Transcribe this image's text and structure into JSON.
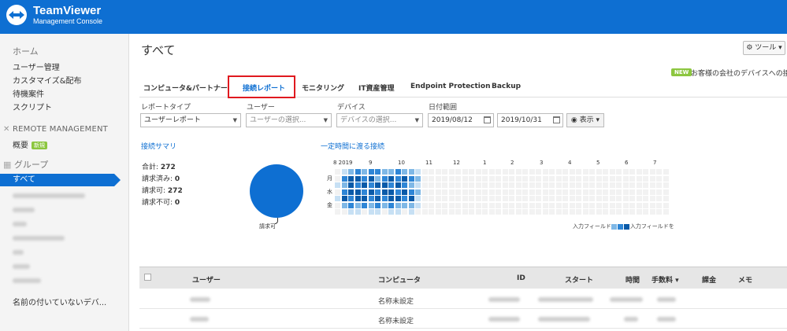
{
  "header": {
    "brand": "TeamViewer",
    "sub": "Management Console",
    "bg_color": "#0e6fd2"
  },
  "sidebar": {
    "home": "ホーム",
    "items": [
      "ユーザー管理",
      "カスタマイズ&配布",
      "待機案件",
      "スクリプト"
    ],
    "remote_heading": "REMOTE MANAGEMENT",
    "overview": "概要",
    "overview_badge": "新規",
    "groups_heading": "グループ",
    "active_group": "すべて",
    "unnamed": "名前の付いていないデバ..."
  },
  "main": {
    "title": "すべて",
    "tools_label": "ツール",
    "new_badge": "NEW",
    "new_text": "お客様の会社のデバイスへの接",
    "tabs": [
      "コンピュータ&パートナー",
      "接続レポート",
      "モニタリング",
      "IT資産管理",
      "Endpoint Protection",
      "Backup"
    ],
    "active_tab": 1
  },
  "filters": {
    "report_type_label": "レポートタイプ",
    "report_type_value": "ユーザーレポート",
    "user_label": "ユーザー",
    "user_placeholder": "ユーザーの選択...",
    "device_label": "デバイス",
    "device_placeholder": "デバイスの選択...",
    "date_label": "日付範囲",
    "date_from": "2019/08/12",
    "date_to": "2019/10/31",
    "show_label": "表示"
  },
  "summary": {
    "title": "接続サマリ",
    "total_label": "合計:",
    "total": "272",
    "billed_label": "請求済み:",
    "billed": "0",
    "billable_label": "請求可:",
    "billable": "272",
    "not_billable_label": "請求不可:",
    "not_billable": "0",
    "pie_label": "請求可"
  },
  "heatmap": {
    "title": "一定時間に渡る接続",
    "months": [
      "8 2019",
      "9",
      "10",
      "11",
      "12",
      "1",
      "2",
      "3",
      "4",
      "5",
      "6",
      "7"
    ],
    "days": [
      "月",
      "水",
      "金"
    ],
    "legend_left": "入力フィールド",
    "legend_right": "入力フィールドを",
    "colors": [
      "#f2f2f2",
      "#c7e0f4",
      "#7fb8e6",
      "#2f86d6",
      "#0a5aa8"
    ]
  },
  "table": {
    "headers": [
      "ユーザー",
      "コンピュータ",
      "ID",
      "スタート",
      "時間",
      "手数料 ▾",
      "課金",
      "メモ"
    ],
    "rows": [
      {
        "computer": "名称未設定"
      },
      {
        "computer": "名称未設定"
      }
    ]
  }
}
